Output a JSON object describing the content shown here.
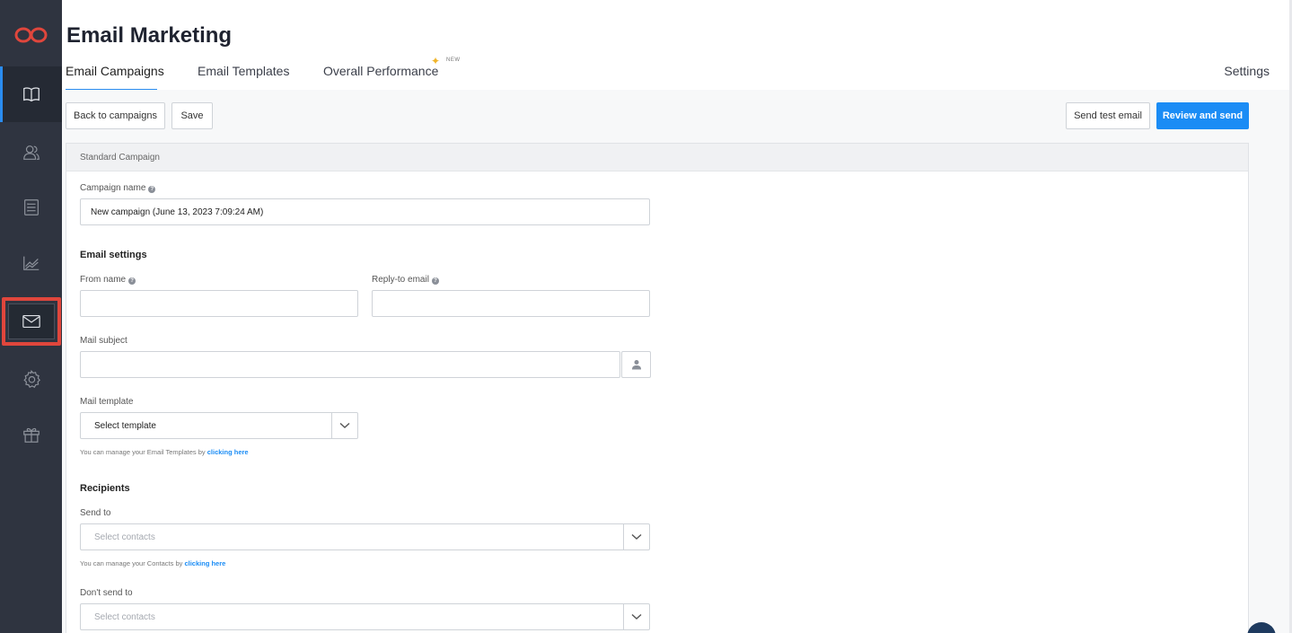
{
  "app": {
    "title": "Email Marketing",
    "brand_color": "#e0463c",
    "accent_color": "#1a8cf5"
  },
  "sidebar": {
    "logo_icon": "infinity-logo-icon",
    "items": [
      {
        "name": "book-icon",
        "active": true
      },
      {
        "name": "contacts-icon",
        "active": false
      },
      {
        "name": "list-icon",
        "active": false
      },
      {
        "name": "chart-icon",
        "active": false
      },
      {
        "name": "mail-icon",
        "active": false,
        "highlighted": true
      },
      {
        "name": "gear-icon",
        "active": false
      },
      {
        "name": "gift-icon",
        "active": false
      }
    ]
  },
  "tabs": [
    {
      "label": "Email Campaigns",
      "active": true
    },
    {
      "label": "Email Templates",
      "active": false
    },
    {
      "label": "Overall Performance",
      "active": false,
      "badge": "NEW"
    }
  ],
  "settings_label": "Settings",
  "toolbar": {
    "back_label": "Back to campaigns",
    "save_label": "Save",
    "test_label": "Send test email",
    "review_label": "Review and send"
  },
  "form": {
    "card_title": "Standard Campaign",
    "campaign_name_label": "Campaign name",
    "campaign_name_value": "New campaign (June 13, 2023 7:09:24 AM)",
    "email_settings_title": "Email settings",
    "from_name_label": "From name",
    "from_name_value": "",
    "reply_to_label": "Reply-to email",
    "reply_to_value": "",
    "subject_label": "Mail subject",
    "subject_value": "",
    "template_label": "Mail template",
    "template_value": "Select template",
    "template_helper": "You can manage your Email Templates by ",
    "template_helper_link": "clicking here",
    "recipients_title": "Recipients",
    "send_to_label": "Send to",
    "send_to_placeholder": "Select contacts",
    "contacts_helper": "You can manage your Contacts by ",
    "contacts_helper_link": "clicking here",
    "dont_send_label": "Don't send to",
    "dont_send_placeholder": "Select contacts"
  }
}
